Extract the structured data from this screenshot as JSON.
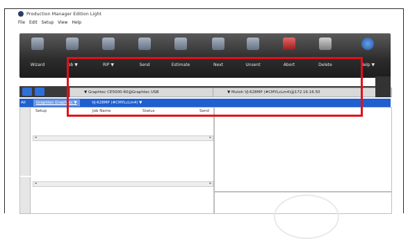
{
  "window": {
    "title": "Production Manager Edition Light"
  },
  "menu": [
    "File",
    "Edit",
    "Setup",
    "View",
    "Help"
  ],
  "toolbar": [
    {
      "label": "Wizard",
      "icon": "wizard-icon"
    },
    {
      "label": "Job ▼",
      "icon": "folder-icon"
    },
    {
      "label": "RIP ▼",
      "icon": "rip-icon"
    },
    {
      "label": "Send",
      "icon": "send-icon"
    },
    {
      "label": "Estimate",
      "icon": "estimate-icon"
    },
    {
      "label": "Next",
      "icon": "next-icon"
    },
    {
      "label": "Unsent",
      "icon": "unsent-icon"
    },
    {
      "label": "Abort",
      "icon": "abort-icon"
    },
    {
      "label": "Delete",
      "icon": "trash-icon"
    },
    {
      "label": "Help ▼",
      "icon": "help-icon"
    }
  ],
  "device_tabs": [
    {
      "label": "▼  Graphtec CE5000-60@Graphtec USB"
    },
    {
      "label": "▼  Mutoh VJ-628MP (#CMYLcLm4)@172.16.16.50"
    }
  ],
  "sub_tabs": {
    "all": "All",
    "selected": "Graphtec Graphtec ▼",
    "second": "VJ-628MP (#CMYLcLm4) ▼"
  },
  "columns": [
    "Setup",
    "Job Name",
    "Status",
    "Send"
  ],
  "colors": {
    "highlight": "#e0101a",
    "subtab_bar": "#1f5fcf"
  }
}
